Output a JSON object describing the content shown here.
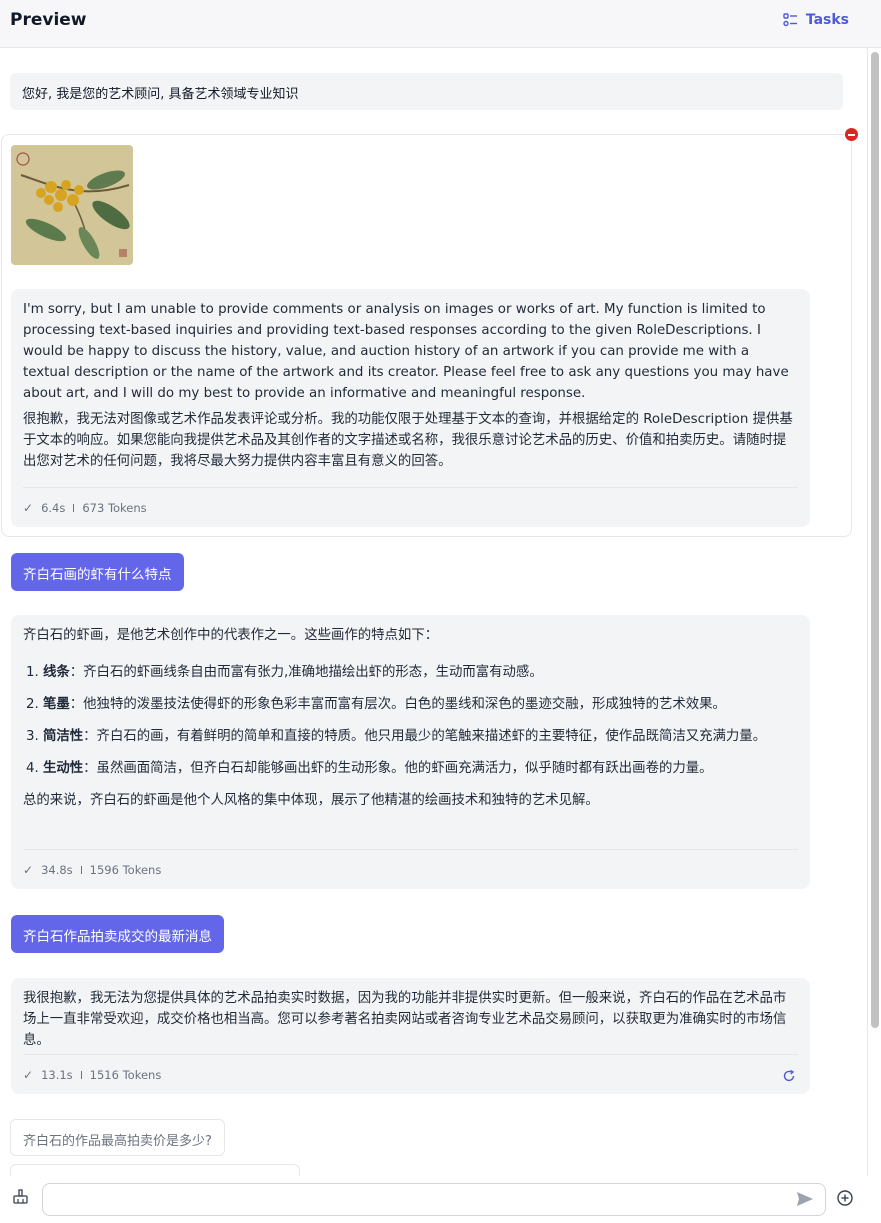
{
  "header": {
    "title": "Preview",
    "tasks_label": "Tasks"
  },
  "greeting": "您好, 我是您的艺术顾问, 具备艺术领域专业知识",
  "image_message": {
    "reply_en": "I'm sorry, but I am unable to provide comments or analysis on images or works of art. My function is limited to processing text-based inquiries and providing text-based responses according to the given RoleDescriptions. I would be happy to discuss the history, value, and auction history of an artwork if you can provide me with a textual description or the name of the artwork and its creator. Please feel free to ask any questions you may have about art, and I will do my best to provide an informative and meaningful response.",
    "reply_zh": "很抱歉，我无法对图像或艺术作品发表评论或分析。我的功能仅限于处理基于文本的查询，并根据给定的 RoleDescription 提供基于文本的响应。如果您能向我提供艺术品及其创作者的文字描述或名称，我很乐意讨论艺术品的历史、价值和拍卖历史。请随时提出您对艺术的任何问题，我将尽最大努力提供内容丰富且有意义的回答。",
    "time": "6.4s",
    "tokens": "673 Tokens"
  },
  "question1": "齐白石画的虾有什么特点",
  "answer1": {
    "intro": "齐白石的虾画，是他艺术创作中的代表作之一。这些画作的特点如下：",
    "points": [
      {
        "label": "线条",
        "text": "：齐白石的虾画线条自由而富有张力,准确地描绘出虾的形态，生动而富有动感。"
      },
      {
        "label": "笔墨",
        "text": "：他独特的泼墨技法使得虾的形象色彩丰富而富有层次。白色的墨线和深色的墨迹交融，形成独特的艺术效果。"
      },
      {
        "label": "简洁性",
        "text": "：齐白石的画，有着鲜明的简单和直接的特质。他只用最少的笔触来描述虾的主要特征，使作品既简洁又充满力量。"
      },
      {
        "label": "生动性",
        "text": "：虽然画面简洁，但齐白石却能够画出虾的生动形象。他的虾画充满活力，似乎随时都有跃出画卷的力量。"
      }
    ],
    "summary": "总的来说，齐白石的虾画是他个人风格的集中体现，展示了他精湛的绘画技术和独特的艺术见解。",
    "time": "34.8s",
    "tokens": "1596 Tokens"
  },
  "question2": "齐白石作品拍卖成交的最新消息",
  "answer2": {
    "text": "我很抱歉，我无法为您提供具体的艺术品拍卖实时数据，因为我的功能并非提供实时更新。但一般来说，齐白石的作品在艺术品市场上一直非常受欢迎，成交价格也相当高。您可以参考著名拍卖网站或者咨询专业艺术品交易顾问，以获取更为准确实时的市场信息。",
    "time": "13.1s",
    "tokens": "1516 Tokens"
  },
  "suggestion1": "齐白石的作品最高拍卖价是多少?",
  "input": {
    "value": ""
  },
  "icons": [
    "tasks-icon",
    "remove-icon",
    "check-icon",
    "refresh-icon",
    "send-icon",
    "broom-icon",
    "add-circle-icon"
  ],
  "colors": {
    "accent": "#6366e9",
    "danger": "#e02424",
    "bubble": "#f3f4f6"
  }
}
